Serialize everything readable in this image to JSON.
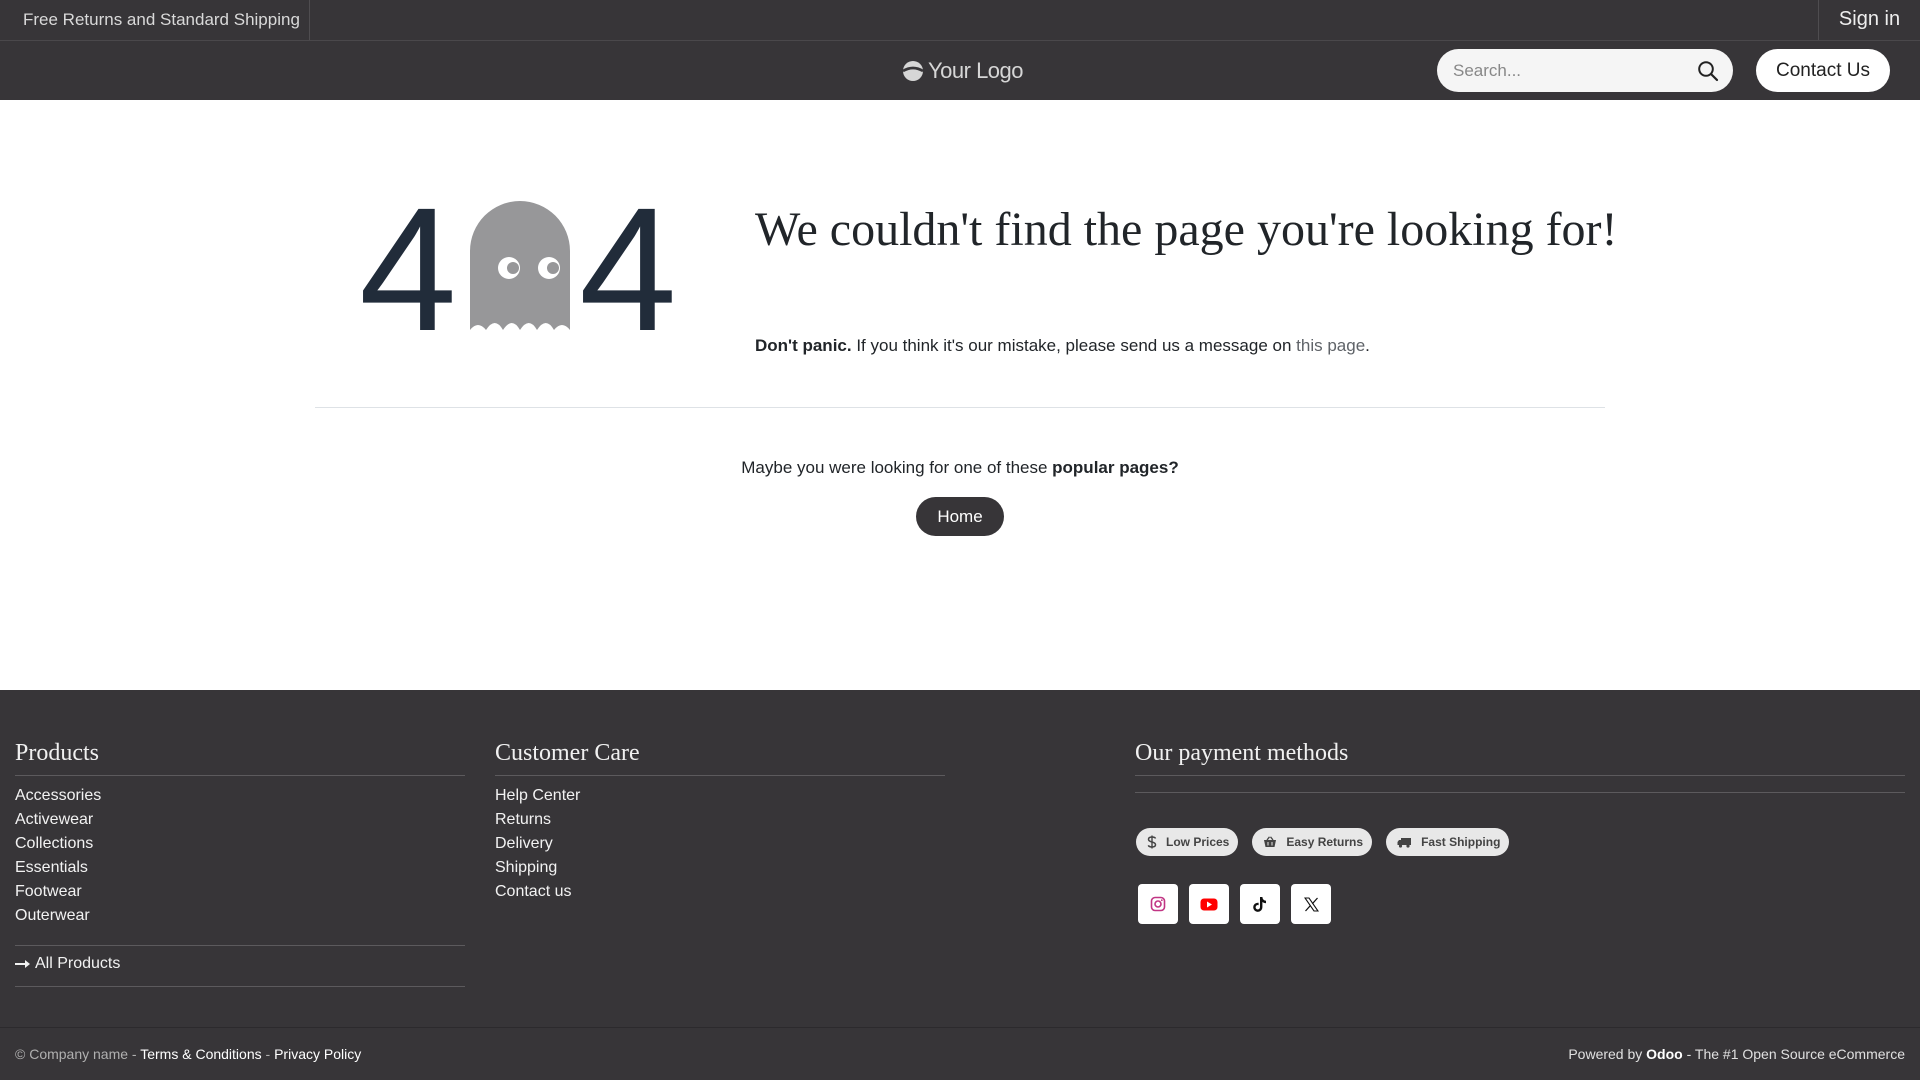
{
  "topbar": {
    "promo": "Free Returns and Standard Shipping",
    "signin": "Sign in"
  },
  "header": {
    "logo_text": "Your Logo",
    "search_placeholder": "Search...",
    "contact_label": "Contact Us"
  },
  "error": {
    "code_left": "4",
    "code_right": "4",
    "title": "We couldn't find the page you're looking for!",
    "msg_bold": "Don't panic.",
    "msg_text": " If you think it's our mistake, please send us a message on ",
    "msg_link": "this page",
    "msg_end": ".",
    "popular_prefix": "Maybe you were looking for one of these ",
    "popular_bold": "popular pages?",
    "home_label": "Home"
  },
  "footer": {
    "products": {
      "title": "Products",
      "items": [
        "Accessories",
        "Activewear",
        "Collections",
        "Essentials",
        "Footwear",
        "Outerwear"
      ],
      "all_label": "All Products"
    },
    "care": {
      "title": "Customer Care",
      "items": [
        "Help Center",
        "Returns",
        "Delivery",
        "Shipping",
        "Contact us"
      ]
    },
    "payment": {
      "title": "Our payment methods",
      "badges": [
        "Low Prices",
        "Easy Returns",
        "Fast Shipping"
      ],
      "badge_icons": [
        "dollar-icon",
        "basket-icon",
        "truck-icon"
      ],
      "socials": [
        "instagram-icon",
        "youtube-icon",
        "tiktok-icon",
        "x-icon"
      ]
    }
  },
  "bottom": {
    "copyright": "© Company name - ",
    "terms": "Terms & Conditions",
    "sep": " - ",
    "privacy": "Privacy Policy",
    "powered_prefix": "Powered by ",
    "powered_brand": "Odoo",
    "powered_suffix": " - The #1 Open Source eCommerce"
  },
  "colors": {
    "dark": "#373538",
    "ghost": "#979799",
    "digits": "#212c3a",
    "instagram": "#c13584",
    "youtube": "#ff0000"
  }
}
